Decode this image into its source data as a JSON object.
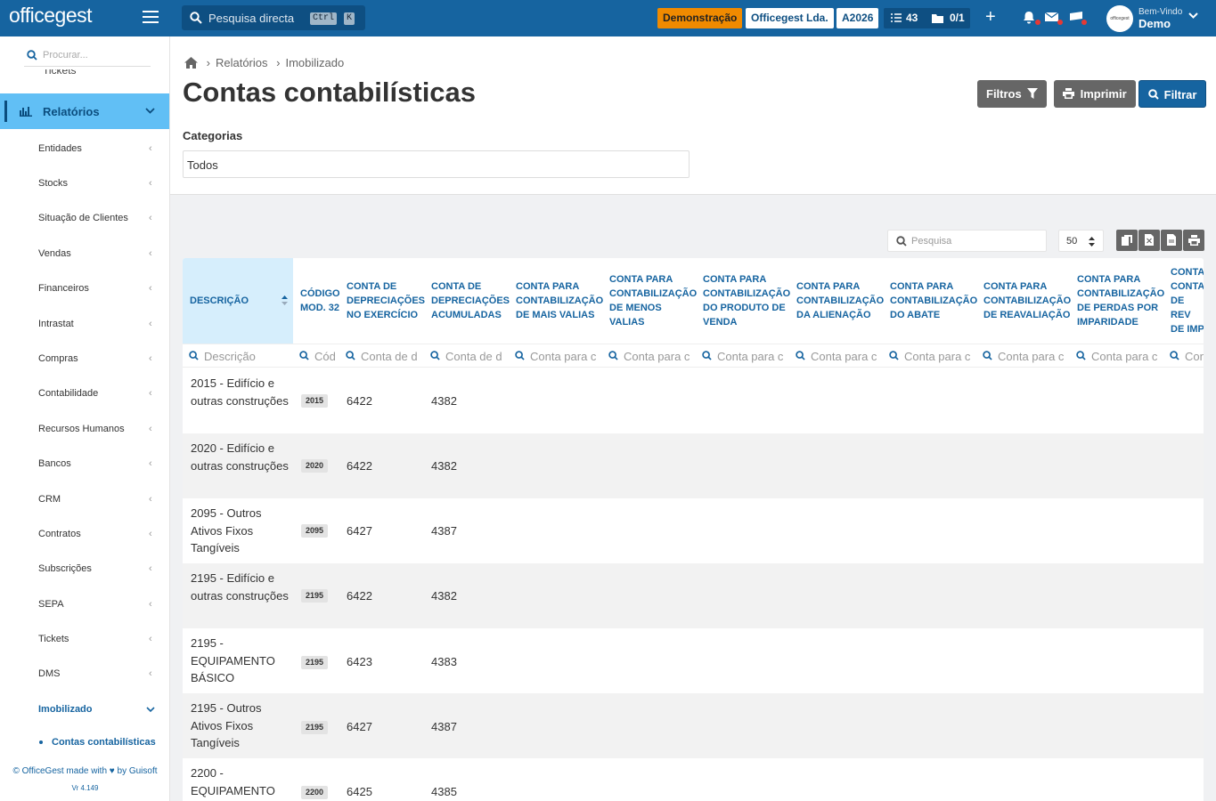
{
  "topbar": {
    "logo": "officegest",
    "search_placeholder": "Pesquisa directa",
    "kbd1": "Ctrl",
    "kbd2": "K",
    "demo": "Demonstração",
    "company": "Officegest Lda.",
    "year": "A2026",
    "tasks_count": "43",
    "docs_count": "0/1",
    "welcome": "Bem-Vindo",
    "user": "Demo",
    "icons": [
      "menu-icon",
      "search-icon",
      "tasks-icon",
      "folder-icon",
      "plus-icon",
      "bell-icon",
      "mail-icon",
      "chat-icon",
      "chevron-down-icon"
    ]
  },
  "sidebar": {
    "search_placeholder": "Procurar...",
    "partial_item": "Tickets",
    "active": "Relatórios",
    "items": [
      "Entidades",
      "Stocks",
      "Situação de Clientes",
      "Vendas",
      "Financeiros",
      "Intrastat",
      "Compras",
      "Contabilidade",
      "Recursos Humanos",
      "Bancos",
      "CRM",
      "Contratos",
      "Subscrições",
      "SEPA",
      "Tickets",
      "DMS"
    ],
    "sub_open": "Imobilizado",
    "sub_item": "Contas contabilísticas",
    "footer": "© OfficeGest made with ♥ by Guisoft",
    "version": "Vr 4.149",
    "active_color": "#61bff5"
  },
  "page": {
    "breadcrumb": [
      "Relatórios",
      "Imobilizado"
    ],
    "title": "Contas contabilísticas",
    "btn_filtros": "Filtros",
    "btn_imprimir": "Imprimir",
    "btn_filtrar": "Filtrar",
    "category_label": "Categorias",
    "category_value": "Todos",
    "table_search_placeholder": "Pesquisa",
    "page_size": "50",
    "accent": "#1664a0"
  },
  "table": {
    "columns": [
      {
        "label": "DESCRIÇÃO",
        "filter": "Descrição"
      },
      {
        "label": "CÓDIGO MOD. 32",
        "filter": "Cód"
      },
      {
        "label": "CONTA DE DEPRECIAÇÕES NO EXERCÍCIO",
        "filter": "Conta de d"
      },
      {
        "label": "CONTA DE DEPRECIAÇÕES ACUMULADAS",
        "filter": "Conta de d"
      },
      {
        "label": "CONTA PARA CONTABILIZAÇÃO DE MAIS VALIAS",
        "filter": "Conta para c"
      },
      {
        "label": "CONTA PARA CONTABILIZAÇÃO DE MENOS VALIAS",
        "filter": "Conta para c"
      },
      {
        "label": "CONTA PARA CONTABILIZAÇÃO DO PRODUTO DE VENDA",
        "filter": "Conta para c"
      },
      {
        "label": "CONTA PARA CONTABILIZAÇÃO DA ALIENAÇÃO",
        "filter": "Conta para c"
      },
      {
        "label": "CONTA PARA CONTABILIZAÇÃO DO ABATE",
        "filter": "Conta para c"
      },
      {
        "label": "CONTA PARA CONTABILIZAÇÃO DE REAVALIAÇÃO",
        "filter": "Conta para c"
      },
      {
        "label": "CONTA PARA CONTABILIZAÇÃO DE PERDAS POR IMPARIDADE",
        "filter": "Conta para c"
      },
      {
        "label": "CONTA CONTA DE REV DE IMP",
        "filter": "Con"
      }
    ],
    "rows": [
      {
        "desc": "2015 - Edifício e outras construções",
        "code": "2015",
        "dep_ex": "6422",
        "dep_acc": "4382"
      },
      {
        "desc": "2020 - Edifício e outras construções",
        "code": "2020",
        "dep_ex": "6422",
        "dep_acc": "4382"
      },
      {
        "desc": "2095 - Outros Ativos Fixos Tangíveis",
        "code": "2095",
        "dep_ex": "6427",
        "dep_acc": "4387"
      },
      {
        "desc": "2195 - Edifício e outras construções",
        "code": "2195",
        "dep_ex": "6422",
        "dep_acc": "4382"
      },
      {
        "desc": "2195 - EQUIPAMENTO BÁSICO",
        "code": "2195",
        "dep_ex": "6423",
        "dep_acc": "4383"
      },
      {
        "desc": "2195 - Outros Ativos Fixos Tangíveis",
        "code": "2195",
        "dep_ex": "6427",
        "dep_acc": "4387"
      },
      {
        "desc": "2200 - EQUIPAMENTO",
        "code": "2200",
        "dep_ex": "6425",
        "dep_acc": "4385"
      }
    ]
  }
}
